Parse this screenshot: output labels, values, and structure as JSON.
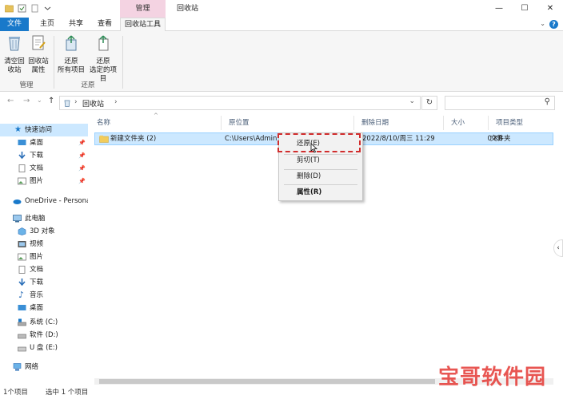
{
  "window": {
    "title": "回收站",
    "context_tab_label": "管理",
    "minimize_glyph": "—",
    "maximize_glyph": "☐",
    "close_glyph": "✕"
  },
  "tabs": [
    {
      "label": "文件"
    },
    {
      "label": "主页"
    },
    {
      "label": "共享"
    },
    {
      "label": "查看"
    },
    {
      "label": "回收站工具"
    }
  ],
  "ribbon": {
    "collapse_glyph": "⌄",
    "help_glyph": "?",
    "groups": [
      {
        "label": "管理",
        "buttons": [
          {
            "label_line1": "清空回",
            "label_line2": "收站"
          },
          {
            "label_line1": "回收站",
            "label_line2": "属性"
          }
        ]
      },
      {
        "label": "还原",
        "buttons": [
          {
            "label_line1": "还原",
            "label_line2": "所有项目"
          },
          {
            "label_line1": "还原",
            "label_line2": "选定的项目"
          }
        ]
      }
    ]
  },
  "address": {
    "back_glyph": "←",
    "forward_glyph": "→",
    "recent_glyph": "⌄",
    "up_glyph": "↑",
    "separator_glyph": "›",
    "path": "回收站",
    "dropdown_glyph": "⌄",
    "refresh_glyph": "↻",
    "search_glyph": "⚲"
  },
  "navpane": {
    "quick_access": "快速访问",
    "quick_items": [
      {
        "label": "桌面",
        "pin": "📌"
      },
      {
        "label": "下载",
        "pin": "📌"
      },
      {
        "label": "文档",
        "pin": "📌"
      },
      {
        "label": "图片",
        "pin": "📌"
      }
    ],
    "onedrive": "OneDrive - Persona",
    "this_pc": "此电脑",
    "pc_items": [
      {
        "label": "3D 对象"
      },
      {
        "label": "视频"
      },
      {
        "label": "图片"
      },
      {
        "label": "文档"
      },
      {
        "label": "下载"
      },
      {
        "label": "音乐"
      },
      {
        "label": "桌面"
      },
      {
        "label": "系统 (C:)"
      },
      {
        "label": "软件 (D:)"
      },
      {
        "label": "U 盘 (E:)"
      }
    ],
    "network": "网络"
  },
  "columns": {
    "sort_glyph": "^",
    "name": "名称",
    "original_location": "原位置",
    "date_deleted": "删除日期",
    "size": "大小",
    "item_type": "项目类型"
  },
  "rows": [
    {
      "name": "新建文件夹 (2)",
      "original_location": "C:\\Users\\Adminis",
      "date_deleted": "2022/8/10/周三 11:29",
      "size": "0 KB",
      "item_type": "文件夹"
    }
  ],
  "context_menu": {
    "items": [
      {
        "label": "还原(E)"
      },
      {
        "label": "剪切(T)"
      },
      {
        "label": "删除(D)"
      },
      {
        "label": "属性(R)"
      }
    ]
  },
  "status": {
    "count": "1个项目",
    "selected": "选中 1 个项目"
  },
  "side_arrow_glyph": "‹",
  "watermark": {
    "text": "宝哥软件园"
  },
  "colors": {
    "accent": "#1979ca",
    "selection": "#cce8ff",
    "context_tab": "#f4d3e2",
    "highlight": "#d12d2d"
  }
}
